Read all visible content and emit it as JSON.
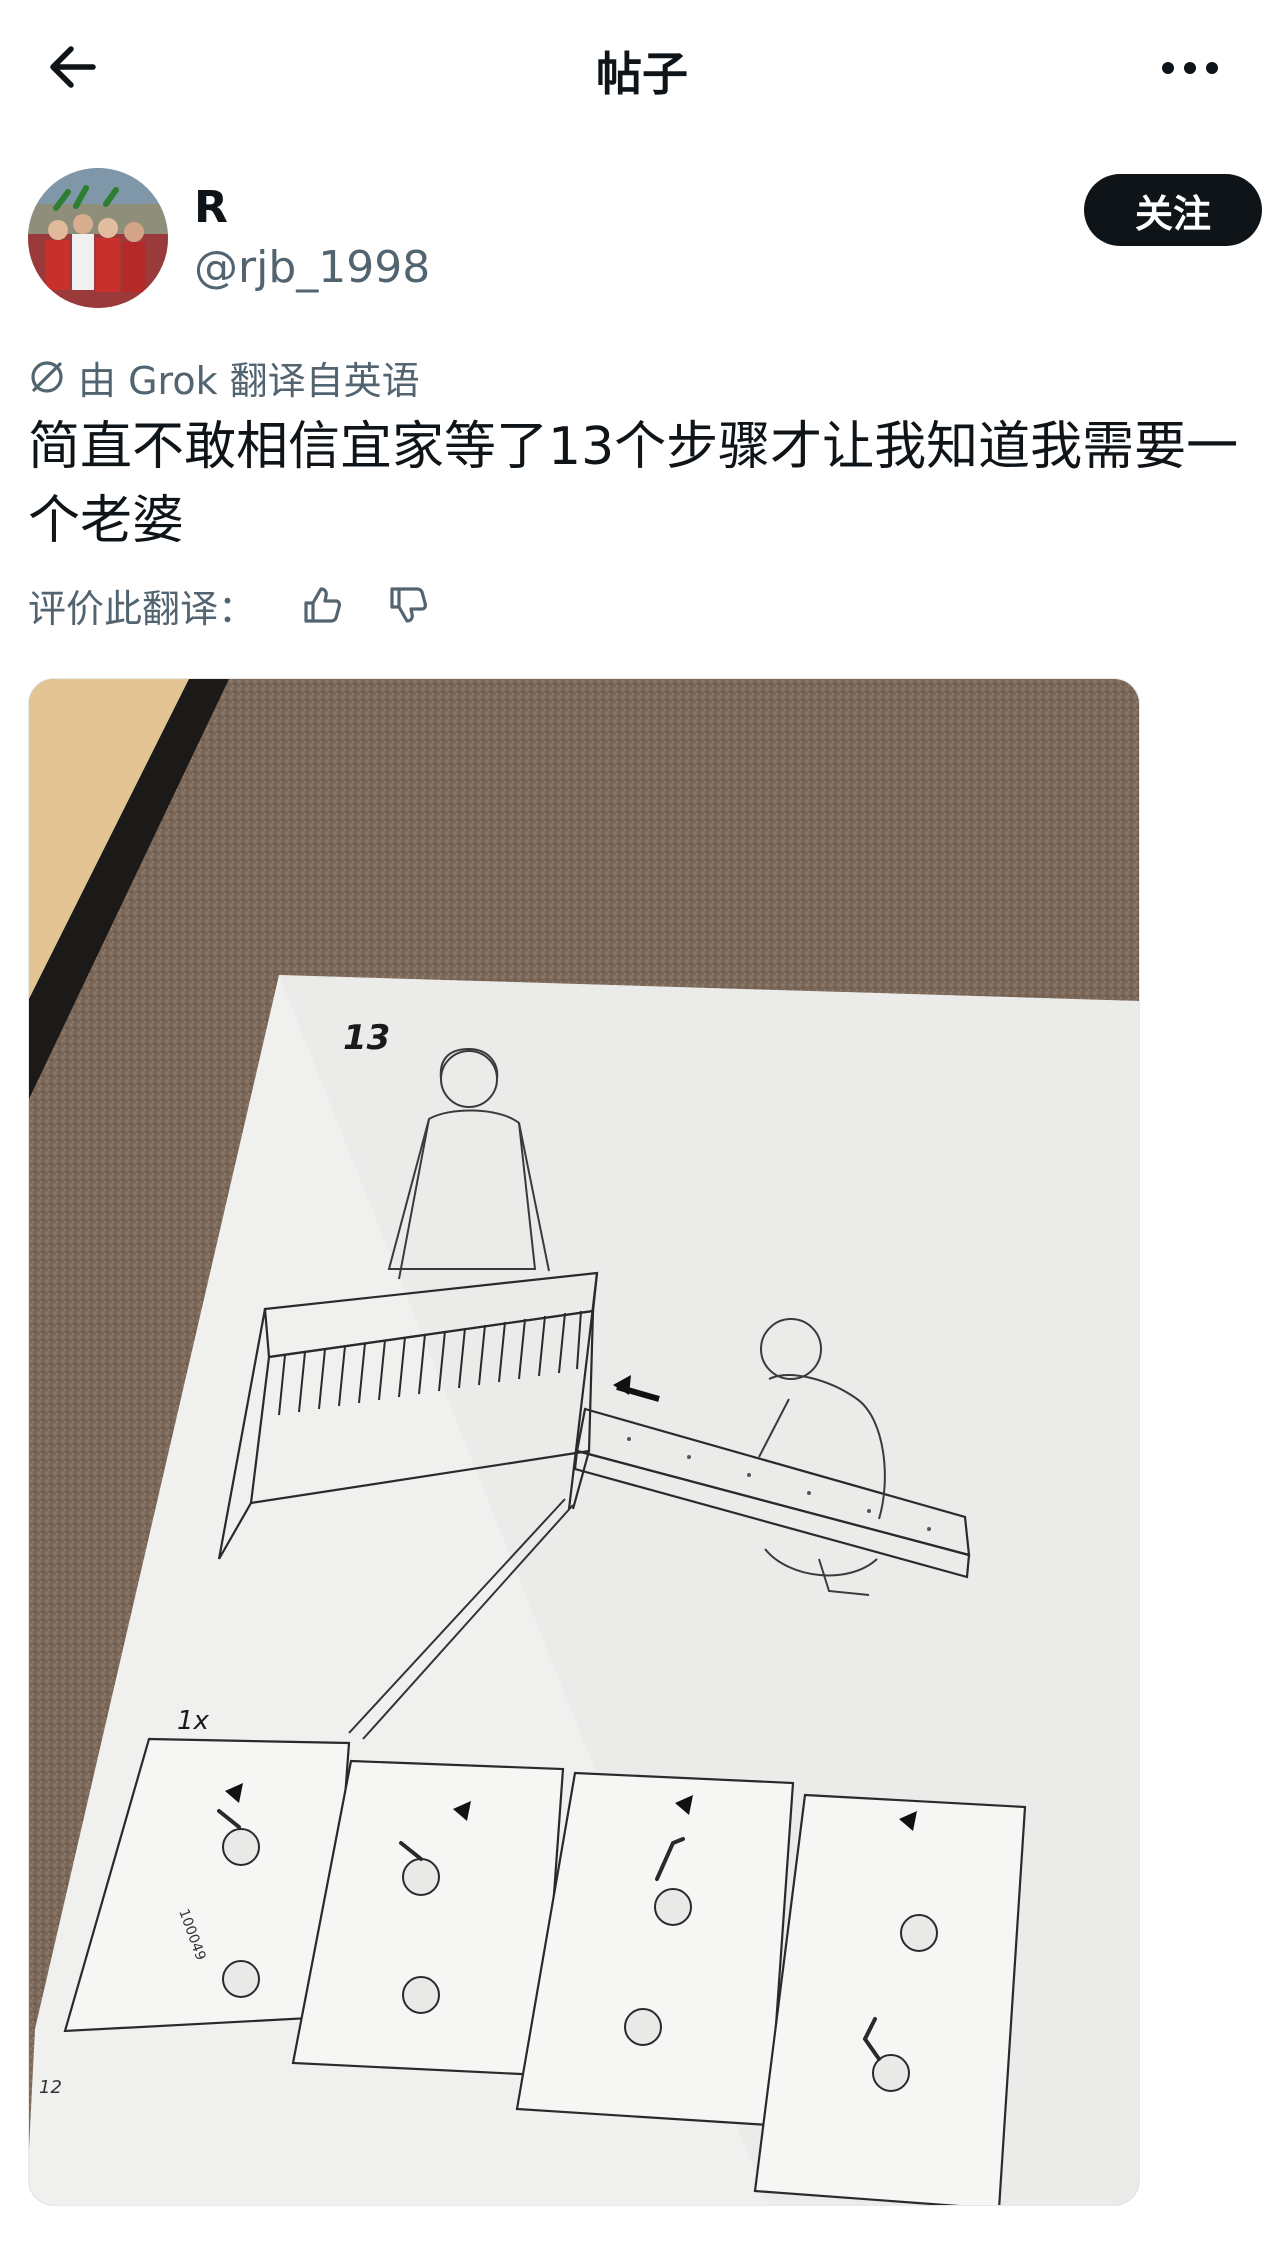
{
  "header": {
    "title": "帖子",
    "back_icon": "arrow-left-icon",
    "more_icon": "more-horizontal-icon"
  },
  "author": {
    "display_name": "R",
    "handle": "@rjb_1998",
    "follow_label": "关注"
  },
  "translation": {
    "label": "由 Grok 翻译自英语",
    "icon": "translate-icon"
  },
  "post": {
    "text": "简直不敢相信宜家等了13个步骤才让我知道我需要一个老婆"
  },
  "rating": {
    "label": "评价此翻译：",
    "up_icon": "thumbs-up-icon",
    "down_icon": "thumbs-down-icon"
  },
  "media": {
    "step_number": "13",
    "detail_count": "1x",
    "part_code": "100049",
    "page_number": "12"
  },
  "colors": {
    "text_primary": "#0f1419",
    "text_secondary": "#536471",
    "button_bg": "#0f1419",
    "carpet": "#7d6a5c"
  }
}
